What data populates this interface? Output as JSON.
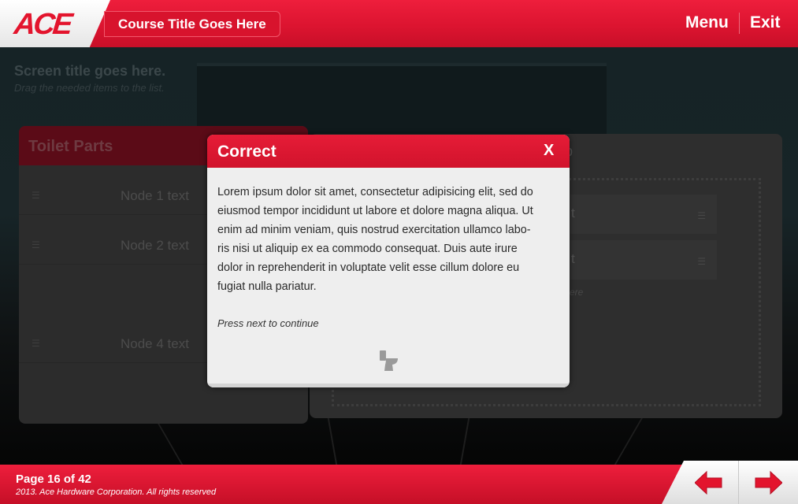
{
  "header": {
    "logo_text": "ACE",
    "course_title": "Course Title Goes Here",
    "menu_label": "Menu",
    "exit_label": "Exit"
  },
  "screen": {
    "title": "Screen title goes here.",
    "subtitle": "Drag the needed items to the list."
  },
  "left_panel": {
    "title": "Toilet Parts",
    "nodes": [
      "Node 1 text",
      "Node 2 text",
      "Node 4 text"
    ]
  },
  "right_panel": {
    "title_fragment": "p",
    "node_fragments": [
      "t",
      "t"
    ],
    "hint_fragment": "ere"
  },
  "modal": {
    "title": "Correct",
    "close_label": "X",
    "body_lines": [
      "Lorem ipsum dolor sit amet, consectetur adipisicing elit, sed do",
      "eiusmod tempor incididunt ut labore et dolore magna aliqua. Ut",
      "enim ad minim veniam, quis nostrud exercitation ullamco labo-",
      "ris nisi ut aliquip ex ea commodo consequat. Duis aute irure",
      "dolor in reprehenderit in voluptate velit esse cillum dolore eu",
      "fugiat nulla pariatur."
    ],
    "hint": "Press next to continue",
    "icon": "toilet-icon"
  },
  "footer": {
    "page_label": "Page 16 of 42",
    "copyright": "2013. Ace Hardware Corporation. All rights reserved",
    "prev_icon": "arrow-left-icon",
    "next_icon": "arrow-right-icon"
  },
  "colors": {
    "brand_red": "#e3142d",
    "modal_bg": "#eeeeee"
  }
}
